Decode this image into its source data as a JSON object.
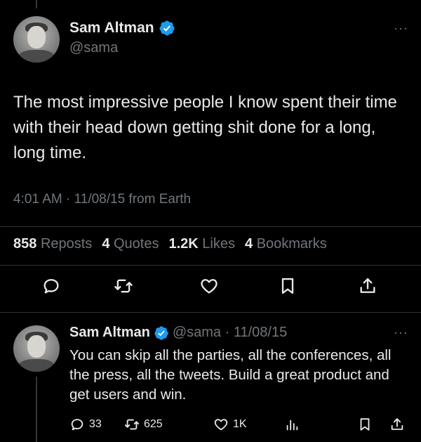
{
  "tweet": {
    "display_name": "Sam Altman",
    "handle": "@sama",
    "more_label": "···",
    "text": "The most impressive people I know spent their time with their head down getting shit done for a long, long time.",
    "meta": "4:01 AM · 11/08/15 from Earth",
    "stats": [
      {
        "num": "858",
        "label": "Reposts"
      },
      {
        "num": "4",
        "label": "Quotes"
      },
      {
        "num": "1.2K",
        "label": "Likes"
      },
      {
        "num": "4",
        "label": "Bookmarks"
      }
    ],
    "actions": [
      "reply-icon",
      "repost-icon",
      "like-icon",
      "bookmark-icon",
      "share-icon"
    ]
  },
  "reply": {
    "display_name": "Sam Altman",
    "handle_date": "@sama · 11/08/15",
    "more_label": "···",
    "text": "You can skip all the parties, all the conferences, all the press, all the tweets.  Build a great product and get users and win.",
    "counts": {
      "replies": "33",
      "reposts": "625",
      "likes": "1K"
    }
  },
  "colors": {
    "background": "#000000",
    "text": "#e7e9ea",
    "muted": "#71767b",
    "verified": "#1d9bf0",
    "divider": "#2f3336"
  }
}
